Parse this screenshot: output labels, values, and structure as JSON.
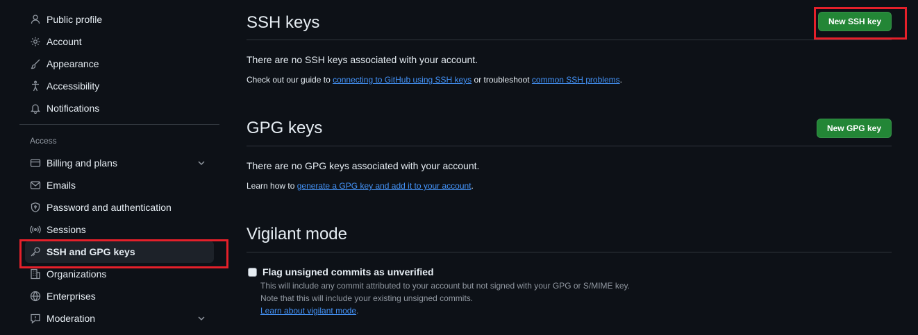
{
  "sidebar": {
    "items_top": [
      {
        "label": "Public profile",
        "icon": "person-icon"
      },
      {
        "label": "Account",
        "icon": "gear-icon"
      },
      {
        "label": "Appearance",
        "icon": "paintbrush-icon"
      },
      {
        "label": "Accessibility",
        "icon": "accessibility-icon"
      },
      {
        "label": "Notifications",
        "icon": "bell-icon"
      }
    ],
    "access_label": "Access",
    "items_access": [
      {
        "label": "Billing and plans",
        "icon": "credit-card-icon"
      },
      {
        "label": "Emails",
        "icon": "mail-icon"
      },
      {
        "label": "Password and authentication",
        "icon": "shield-lock-icon"
      },
      {
        "label": "Sessions",
        "icon": "broadcast-icon"
      },
      {
        "label": "SSH and GPG keys",
        "icon": "key-icon"
      },
      {
        "label": "Organizations",
        "icon": "organization-icon"
      },
      {
        "label": "Enterprises",
        "icon": "globe-icon"
      },
      {
        "label": "Moderation",
        "icon": "report-icon"
      }
    ]
  },
  "ssh": {
    "title": "SSH keys",
    "button": "New SSH key",
    "empty": "There are no SSH keys associated with your account.",
    "help_prefix": "Check out our guide to ",
    "help_link1": "connecting to GitHub using SSH keys",
    "help_mid": " or troubleshoot ",
    "help_link2": "common SSH problems",
    "help_suffix": "."
  },
  "gpg": {
    "title": "GPG keys",
    "button": "New GPG key",
    "empty": "There are no GPG keys associated with your account.",
    "help_prefix": "Learn how to ",
    "help_link": "generate a GPG key and add it to your account",
    "help_suffix": "."
  },
  "vigilant": {
    "title": "Vigilant mode",
    "checkbox_label": "Flag unsigned commits as unverified",
    "checked": false,
    "note1": "This will include any commit attributed to your account but not signed with your GPG or S/MIME key.",
    "note2": "Note that this will include your existing unsigned commits.",
    "learn_link": "Learn about vigilant mode",
    "learn_suffix": "."
  },
  "colors": {
    "background": "#0d1117",
    "accent_green": "#238636",
    "link": "#4493f8",
    "highlight_box": "#e5202a"
  }
}
